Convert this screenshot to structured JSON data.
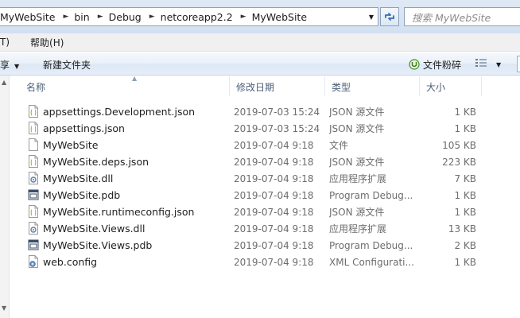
{
  "address": {
    "crumbs": [
      "MyWebSite",
      "bin",
      "Debug",
      "netcoreapp2.2",
      "MyWebSite"
    ],
    "search_placeholder": "搜索 MyWebSite"
  },
  "menu": {
    "items": [
      "T)",
      "帮助(H)"
    ]
  },
  "toolbar": {
    "share_label": "享",
    "new_folder_label": "新建文件夹",
    "shred_label": "文件粉碎"
  },
  "columns": {
    "name": "名称",
    "date": "修改日期",
    "type": "类型",
    "size": "大小"
  },
  "files": [
    {
      "name": "appsettings.Development.json",
      "date": "2019-07-03 15:24",
      "type": "JSON 源文件",
      "size": "1 KB",
      "icon": "json-file-icon"
    },
    {
      "name": "appsettings.json",
      "date": "2019-07-03 15:24",
      "type": "JSON 源文件",
      "size": "1 KB",
      "icon": "json-file-icon"
    },
    {
      "name": "MyWebSite",
      "date": "2019-07-04 9:18",
      "type": "文件",
      "size": "105 KB",
      "icon": "file-icon"
    },
    {
      "name": "MyWebSite.deps.json",
      "date": "2019-07-04 9:18",
      "type": "JSON 源文件",
      "size": "223 KB",
      "icon": "json-file-icon"
    },
    {
      "name": "MyWebSite.dll",
      "date": "2019-07-04 9:18",
      "type": "应用程序扩展",
      "size": "7 KB",
      "icon": "dll-file-icon"
    },
    {
      "name": "MyWebSite.pdb",
      "date": "2019-07-04 9:18",
      "type": "Program Debug...",
      "size": "1 KB",
      "icon": "pdb-file-icon"
    },
    {
      "name": "MyWebSite.runtimeconfig.json",
      "date": "2019-07-04 9:18",
      "type": "JSON 源文件",
      "size": "1 KB",
      "icon": "json-file-icon"
    },
    {
      "name": "MyWebSite.Views.dll",
      "date": "2019-07-04 9:18",
      "type": "应用程序扩展",
      "size": "13 KB",
      "icon": "dll-file-icon"
    },
    {
      "name": "MyWebSite.Views.pdb",
      "date": "2019-07-04 9:18",
      "type": "Program Debug...",
      "size": "2 KB",
      "icon": "pdb-file-icon"
    },
    {
      "name": "web.config",
      "date": "2019-07-04 9:18",
      "type": "XML Configurati...",
      "size": "1 KB",
      "icon": "config-file-icon"
    }
  ]
}
